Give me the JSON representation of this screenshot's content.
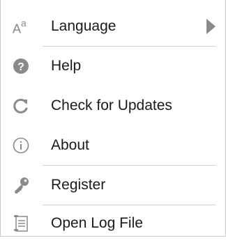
{
  "menu": {
    "items": [
      {
        "label": "Language",
        "icon": "language-icon",
        "has_submenu": true
      },
      {
        "label": "Help",
        "icon": "help-icon",
        "has_submenu": false
      },
      {
        "label": "Check for Updates",
        "icon": "refresh-icon",
        "has_submenu": false
      },
      {
        "label": "About",
        "icon": "info-icon",
        "has_submenu": false
      },
      {
        "label": "Register",
        "icon": "key-icon",
        "has_submenu": false
      },
      {
        "label": "Open Log File",
        "icon": "log-file-icon",
        "has_submenu": false
      }
    ]
  },
  "colors": {
    "text": "#1a1a1a",
    "icon": "#8a8a8a",
    "separator": "#cfcfcf",
    "background": "#ffffff"
  }
}
